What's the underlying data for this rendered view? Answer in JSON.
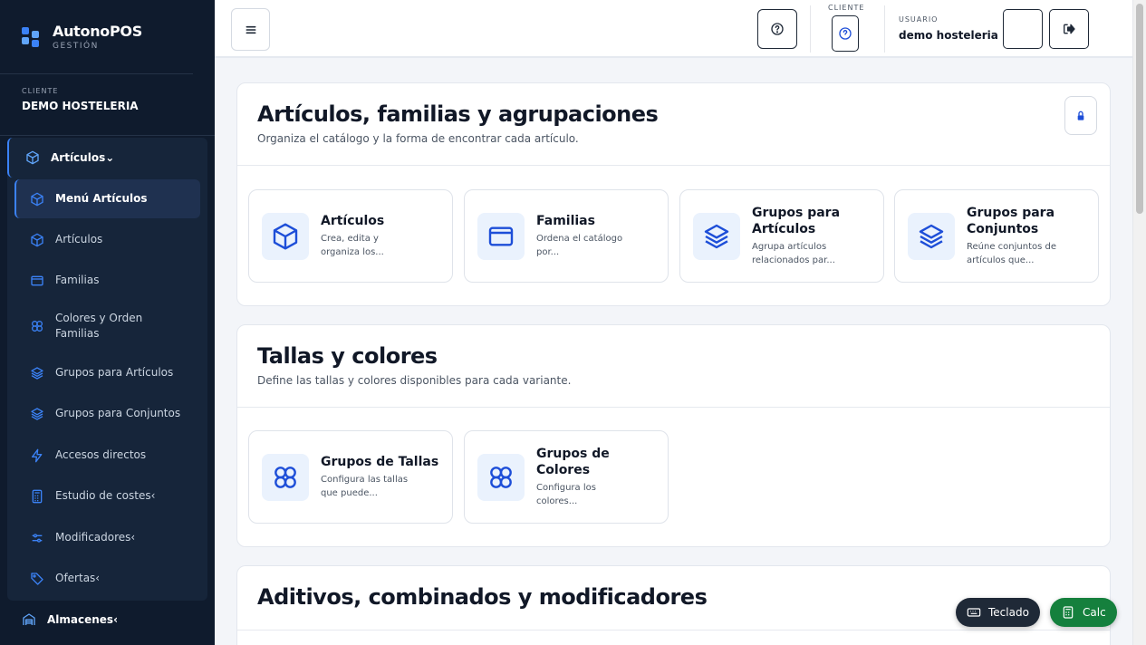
{
  "brand": {
    "name": "AutonoPOS",
    "sub": "GESTIÓN"
  },
  "client": {
    "label": "CLIENTE",
    "name": "DEMO HOSTELERIA"
  },
  "sidebar": {
    "group_label": "Artículos⌄",
    "items": [
      {
        "label": "Menú Artículos",
        "icon": "cube-icon",
        "active": true
      },
      {
        "label": "Artículos",
        "icon": "cube-icon"
      },
      {
        "label": "Familias",
        "icon": "folder-icon"
      },
      {
        "label": "Colores y Orden Familias",
        "icon": "flower-icon"
      },
      {
        "label": "Grupos para Artículos",
        "icon": "layers-icon"
      },
      {
        "label": "Grupos para Conjuntos",
        "icon": "layers-icon"
      },
      {
        "label": "Accesos directos",
        "icon": "bolt-icon"
      },
      {
        "label": "Estudio de costes‹",
        "icon": "calculator-icon"
      },
      {
        "label": "Modificadores‹",
        "icon": "sliders-icon"
      },
      {
        "label": "Ofertas‹",
        "icon": "tag-icon"
      }
    ],
    "bottom": {
      "label": "Almacenes‹",
      "icon": "warehouse-icon"
    }
  },
  "topbar": {
    "client_label": "CLIENTE",
    "user_label": "USUARIO",
    "user_name": "demo hosteleria"
  },
  "sections": [
    {
      "title": "Artículos, familias y agrupaciones",
      "subtitle": "Organiza el catálogo y la forma de encontrar cada artículo.",
      "tiles": [
        {
          "title": "Artículos",
          "desc": "Crea, edita y organiza los...",
          "icon": "cube-icon"
        },
        {
          "title": "Familias",
          "desc": "Ordena el catálogo por...",
          "icon": "folder-icon"
        },
        {
          "title": "Grupos para Artículos",
          "desc": "Agrupa artículos relacionados par...",
          "icon": "layers-icon"
        },
        {
          "title": "Grupos para Conjuntos",
          "desc": "Reúne conjuntos de artículos que...",
          "icon": "layers-icon"
        }
      ]
    },
    {
      "title": "Tallas y colores",
      "subtitle": "Define las tallas y colores disponibles para cada variante.",
      "tiles": [
        {
          "title": "Grupos de Tallas",
          "desc": "Configura las tallas que puede...",
          "icon": "flower-icon"
        },
        {
          "title": "Grupos de Colores",
          "desc": "Configura los colores...",
          "icon": "flower-icon"
        }
      ]
    },
    {
      "title": "Aditivos, combinados y modificadores"
    }
  ],
  "fabs": {
    "teclado": "Teclado",
    "calc": "Calc"
  },
  "colors": {
    "sidebar": "#0f1b2d",
    "accent": "#3b82f6",
    "calc": "#15803d"
  }
}
